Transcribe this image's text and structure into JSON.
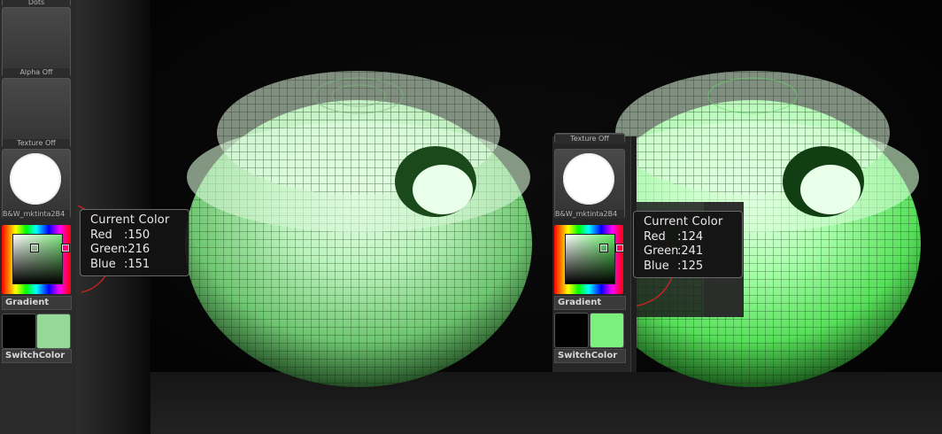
{
  "left_tray": {
    "top_label": "Dots",
    "alpha_label": "Alpha Off",
    "texture_label": "Texture Off",
    "material_label": "B&W_mktinta2B4",
    "gradient_label": "Gradient",
    "switch_label": "SwitchColor",
    "main_swatch_color": "#96d897",
    "secondary_swatch_color": "#000000",
    "picker_color": "#96d897"
  },
  "right_tray": {
    "texture_label": "Texture Off",
    "material_label": "B&W_mktinta2B4",
    "gradient_label": "Gradient",
    "switch_label": "SwitchColor",
    "main_swatch_color": "#7cf17d",
    "secondary_swatch_color": "#000000",
    "picker_color": "#7cf17d"
  },
  "tooltip_left": {
    "title": "Current Color",
    "red_label": "Red",
    "red_value": ":150",
    "green_label": "Green",
    "green_value": ":216",
    "blue_label": "Blue",
    "blue_value": ":151"
  },
  "tooltip_right": {
    "title": "Current Color",
    "red_label": "Red",
    "red_value": ":124",
    "green_label": "Green",
    "green_value": ":241",
    "blue_label": "Blue",
    "blue_value": ":125"
  },
  "colors": {
    "left_model": "#96d897",
    "right_model": "#7cf17d",
    "tray_bg": "#2a2a2a",
    "viewport_bg": "#000000"
  }
}
